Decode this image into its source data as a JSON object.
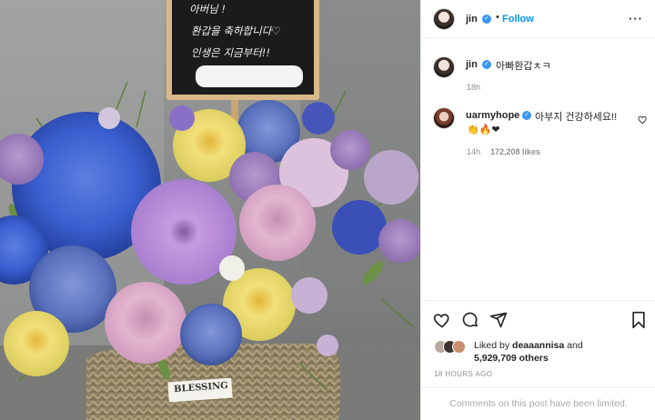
{
  "photo": {
    "sign_lines": [
      "아버님 !",
      "환갑을 축하합니다♡",
      "인생은 지금부터!!"
    ],
    "basket_tag": "BLESSING"
  },
  "post": {
    "author": "jin",
    "follow_label": "Follow",
    "more_label": "···",
    "caption": {
      "username": "jin",
      "text": "아빠환갑ㅊㅋ",
      "time": "18h"
    },
    "comments": [
      {
        "username": "uarmyhope",
        "text": "아부지 건강하세요!!",
        "emojis": "👏🔥❤",
        "time": "14h",
        "likes": "172,208 likes"
      }
    ],
    "likes": {
      "prefix": "Liked by",
      "user": "deaaannisa",
      "and": "and",
      "others": "5,929,709 others"
    },
    "time_ago": "18 HOURS AGO",
    "comments_disabled": "Comments on this post have been limited."
  },
  "colors": {
    "link_blue": "#0095f6",
    "verified_blue": "#3897f0",
    "muted": "#8e8e8e",
    "divider": "#efefef"
  }
}
